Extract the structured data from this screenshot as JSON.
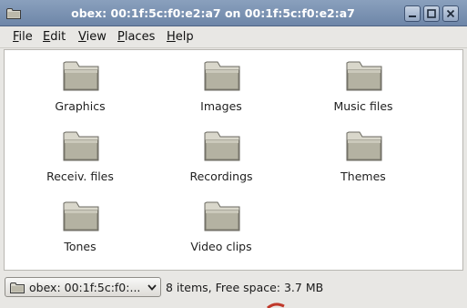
{
  "window": {
    "title": "obex: 00:1f:5c:f0:e2:a7 on 00:1f:5c:f0:e2:a7"
  },
  "menu": [
    {
      "label": "File",
      "mnemonic": "F",
      "rest": "ile"
    },
    {
      "label": "Edit",
      "mnemonic": "E",
      "rest": "dit"
    },
    {
      "label": "View",
      "mnemonic": "V",
      "rest": "iew"
    },
    {
      "label": "Places",
      "mnemonic": "P",
      "rest": "laces"
    },
    {
      "label": "Help",
      "mnemonic": "H",
      "rest": "elp"
    }
  ],
  "folders": [
    {
      "name": "Graphics",
      "icon": "folder-icon"
    },
    {
      "name": "Images",
      "icon": "folder-icon"
    },
    {
      "name": "Music files",
      "icon": "folder-icon"
    },
    {
      "name": "Receiv. files",
      "icon": "folder-icon"
    },
    {
      "name": "Recordings",
      "icon": "folder-icon"
    },
    {
      "name": "Themes",
      "icon": "folder-icon"
    },
    {
      "name": "Tones",
      "icon": "folder-icon"
    },
    {
      "name": "Video clips",
      "icon": "folder-icon"
    }
  ],
  "status": {
    "location": "obex: 00:1f:5c:f0:...",
    "summary": "8 items, Free space: 3.7 MB"
  },
  "colors": {
    "titlebar": "#7b91b2",
    "folder": "#b7b5a5",
    "content_bg": "#ffffff"
  }
}
